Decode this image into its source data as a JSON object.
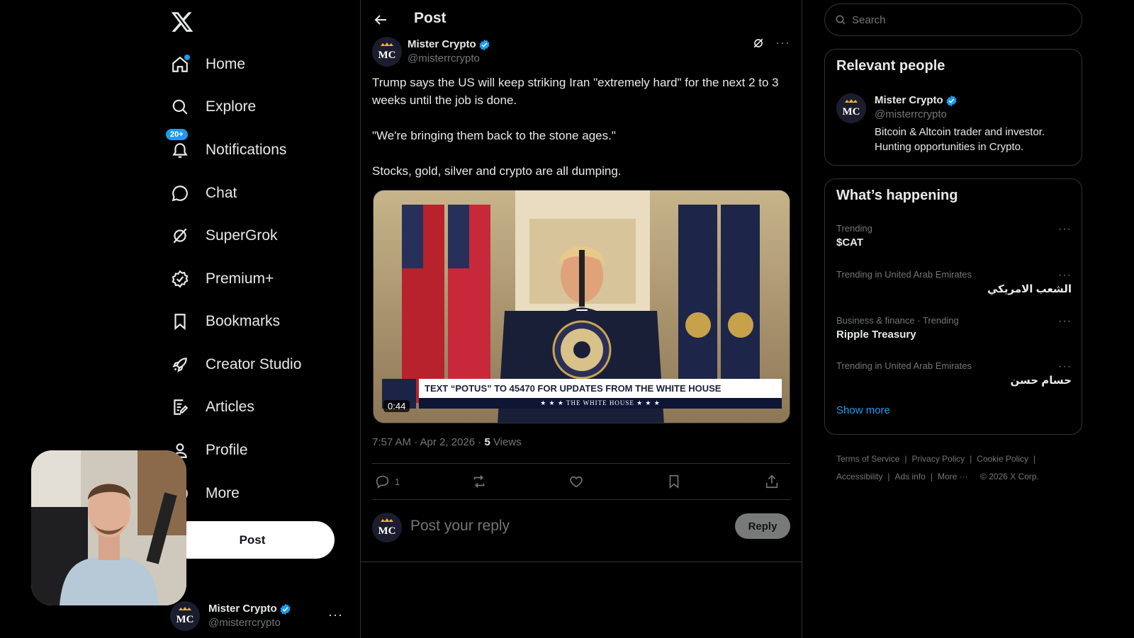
{
  "nav": {
    "items": [
      {
        "key": "home",
        "label": "Home",
        "icon": "home-icon"
      },
      {
        "key": "explore",
        "label": "Explore",
        "icon": "search-icon"
      },
      {
        "key": "notifications",
        "label": "Notifications",
        "icon": "bell-icon",
        "badge": "20+"
      },
      {
        "key": "chat",
        "label": "Chat",
        "icon": "chat-bubble-icon"
      },
      {
        "key": "supergrok",
        "label": "SuperGrok",
        "icon": "grok-icon"
      },
      {
        "key": "premium",
        "label": "Premium+",
        "icon": "premium-badge-icon"
      },
      {
        "key": "bookmarks",
        "label": "Bookmarks",
        "icon": "bookmark-icon"
      },
      {
        "key": "creator",
        "label": "Creator Studio",
        "icon": "rocket-icon"
      },
      {
        "key": "articles",
        "label": "Articles",
        "icon": "article-edit-icon"
      },
      {
        "key": "profile",
        "label": "Profile",
        "icon": "person-icon"
      },
      {
        "key": "more",
        "label": "More",
        "icon": "more-circle-icon"
      }
    ],
    "post_button": "Post",
    "account": {
      "name": "Mister Crypto",
      "handle": "@misterrcrypto"
    }
  },
  "center": {
    "title": "Post",
    "author": {
      "name": "Mister Crypto",
      "handle": "@misterrcrypto"
    },
    "text": {
      "p1": "Trump says the US will keep striking Iran \"extremely hard\" for the next 2 to 3 weeks until the job is done.",
      "p2": "\"We're bringing them back to the stone ages.\"",
      "p3": "Stocks, gold, silver and crypto are all dumping."
    },
    "media": {
      "chyron": "TEXT “POTUS” TO 45470 FOR UPDATES FROM THE WHITE HOUSE",
      "chyron_sub": "★ ★ ★  THE WHITE HOUSE  ★ ★ ★",
      "duration": "0:44"
    },
    "meta": {
      "time": "7:57 AM · Apr 2, 2026 · ",
      "views_count": "5",
      "views_label": " Views"
    },
    "actions": {
      "reply_count": "1"
    },
    "reply": {
      "placeholder": "Post your reply",
      "button": "Reply"
    }
  },
  "right": {
    "search_placeholder": "Search",
    "relevant": {
      "title": "Relevant people",
      "name": "Mister Crypto",
      "handle": "@misterrcrypto",
      "bio": "Bitcoin & Altcoin trader and investor. Hunting opportunities in Crypto."
    },
    "happening": {
      "title": "What’s happening",
      "trends": [
        {
          "meta": "Trending",
          "name": "$CAT"
        },
        {
          "meta": "Trending in United Arab Emirates",
          "name": "الشعب الامريكي"
        },
        {
          "meta": "Business & finance · Trending",
          "name": "Ripple Treasury"
        },
        {
          "meta": "Trending in United Arab Emirates",
          "name": "حسام حسن"
        }
      ],
      "show_more": "Show more"
    },
    "footer": {
      "terms": "Terms of Service",
      "privacy": "Privacy Policy",
      "cookie": "Cookie Policy",
      "accessibility": "Accessibility",
      "ads": "Ads info",
      "more": "More ···",
      "copyright": "© 2026 X Corp."
    }
  },
  "colors": {
    "accent": "#1d9bf0",
    "background": "#000000",
    "border": "#2f3336",
    "muted": "#71767b"
  }
}
